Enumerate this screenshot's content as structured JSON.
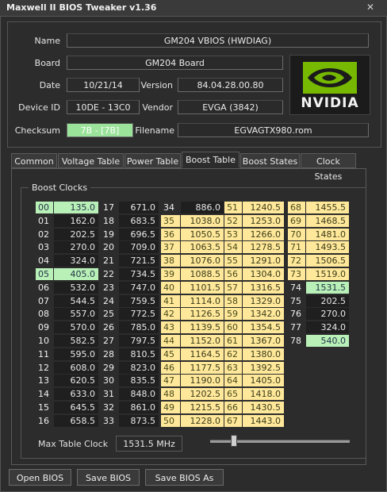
{
  "window": {
    "title": "Maxwell II BIOS Tweaker v1.36",
    "close_glyph": "✕"
  },
  "info": {
    "name_label": "Name",
    "name_value": "GM204 VBIOS (HWDIAG)",
    "board_label": "Board",
    "board_value": "GM204 Board",
    "date_label": "Date",
    "date_value": "10/21/14",
    "version_label": "Version",
    "version_value": "84.04.28.00.80",
    "device_label": "Device ID",
    "device_value": "10DE - 13C0",
    "vendor_label": "Vendor",
    "vendor_value": "EVGA (3842)",
    "checksum_label": "Checksum",
    "checksum_value": "7B - [7B]",
    "filename_label": "Filename",
    "filename_value": "EGVAGTX980.rom",
    "logo_text": "NVIDIA",
    "checksum_color": "#9be39b"
  },
  "tabs": [
    "Common",
    "Voltage Table",
    "Power Table",
    "Boost Table",
    "Boost States",
    "Clock States"
  ],
  "active_tab": "Boost Table",
  "boost": {
    "group_title": "Boost Clocks",
    "columns": [
      [
        [
          "00",
          "135.0",
          "green"
        ],
        [
          "01",
          "162.0",
          ""
        ],
        [
          "02",
          "202.5",
          ""
        ],
        [
          "03",
          "270.0",
          ""
        ],
        [
          "04",
          "324.0",
          ""
        ],
        [
          "05",
          "405.0",
          "green"
        ],
        [
          "06",
          "532.0",
          ""
        ],
        [
          "07",
          "544.5",
          ""
        ],
        [
          "08",
          "557.0",
          ""
        ],
        [
          "09",
          "570.0",
          ""
        ],
        [
          "10",
          "582.5",
          ""
        ],
        [
          "11",
          "595.0",
          ""
        ],
        [
          "12",
          "608.0",
          ""
        ],
        [
          "13",
          "620.5",
          ""
        ],
        [
          "14",
          "633.0",
          ""
        ],
        [
          "15",
          "645.5",
          ""
        ],
        [
          "16",
          "658.5",
          ""
        ]
      ],
      [
        [
          "17",
          "671.0",
          ""
        ],
        [
          "18",
          "683.5",
          ""
        ],
        [
          "19",
          "696.5",
          ""
        ],
        [
          "20",
          "709.0",
          ""
        ],
        [
          "21",
          "721.5",
          ""
        ],
        [
          "22",
          "734.5",
          ""
        ],
        [
          "23",
          "747.0",
          ""
        ],
        [
          "24",
          "759.5",
          ""
        ],
        [
          "25",
          "772.5",
          ""
        ],
        [
          "26",
          "785.0",
          ""
        ],
        [
          "27",
          "797.5",
          ""
        ],
        [
          "28",
          "810.5",
          ""
        ],
        [
          "29",
          "823.0",
          ""
        ],
        [
          "30",
          "835.5",
          ""
        ],
        [
          "31",
          "848.0",
          ""
        ],
        [
          "32",
          "861.0",
          ""
        ],
        [
          "33",
          "873.5",
          ""
        ]
      ],
      [
        [
          "34",
          "886.0",
          ""
        ],
        [
          "35",
          "1038.0",
          "boost"
        ],
        [
          "36",
          "1050.5",
          "boost"
        ],
        [
          "37",
          "1063.5",
          "boost"
        ],
        [
          "38",
          "1076.0",
          "boost"
        ],
        [
          "39",
          "1088.5",
          "boost"
        ],
        [
          "40",
          "1101.5",
          "boost"
        ],
        [
          "41",
          "1114.0",
          "boost"
        ],
        [
          "42",
          "1126.5",
          "boost"
        ],
        [
          "43",
          "1139.5",
          "boost"
        ],
        [
          "44",
          "1152.0",
          "boost"
        ],
        [
          "45",
          "1164.5",
          "boost"
        ],
        [
          "46",
          "1177.5",
          "boost"
        ],
        [
          "47",
          "1190.0",
          "boost"
        ],
        [
          "48",
          "1202.5",
          "boost"
        ],
        [
          "49",
          "1215.5",
          "boost"
        ],
        [
          "50",
          "1228.0",
          "boost"
        ]
      ],
      [
        [
          "51",
          "1240.5",
          "boost"
        ],
        [
          "52",
          "1253.0",
          "boost"
        ],
        [
          "53",
          "1266.0",
          "boost"
        ],
        [
          "54",
          "1278.5",
          "boost"
        ],
        [
          "55",
          "1291.0",
          "boost"
        ],
        [
          "56",
          "1304.0",
          "boost"
        ],
        [
          "57",
          "1316.5",
          "boost"
        ],
        [
          "58",
          "1329.0",
          "boost"
        ],
        [
          "59",
          "1342.0",
          "boost"
        ],
        [
          "60",
          "1354.5",
          "boost"
        ],
        [
          "61",
          "1367.0",
          "boost"
        ],
        [
          "62",
          "1380.0",
          "boost"
        ],
        [
          "63",
          "1392.5",
          "boost"
        ],
        [
          "64",
          "1405.0",
          "boost"
        ],
        [
          "65",
          "1418.0",
          "boost"
        ],
        [
          "66",
          "1430.5",
          "boost"
        ],
        [
          "67",
          "1443.0",
          "boost"
        ]
      ],
      [
        [
          "68",
          "1455.5",
          "boost"
        ],
        [
          "69",
          "1468.5",
          "boost"
        ],
        [
          "70",
          "1481.0",
          "boost"
        ],
        [
          "71",
          "1493.5",
          "boost"
        ],
        [
          "72",
          "1506.5",
          "boost"
        ],
        [
          "73",
          "1519.0",
          "boost"
        ],
        [
          "74",
          "1531.5",
          "green"
        ],
        [
          "75",
          "202.5",
          ""
        ],
        [
          "76",
          "270.0",
          ""
        ],
        [
          "77",
          "324.0",
          ""
        ],
        [
          "78",
          "540.0",
          "green"
        ]
      ]
    ],
    "max_label": "Max Table Clock",
    "max_value": "1531.5 MHz",
    "slider_position": 0.17
  },
  "buttons": {
    "open": "Open BIOS",
    "save": "Save BIOS",
    "save_as": "Save BIOS As"
  },
  "colors": {
    "boost_cell": "#ffe89a",
    "highlight_cell": "#b8f0b8"
  }
}
